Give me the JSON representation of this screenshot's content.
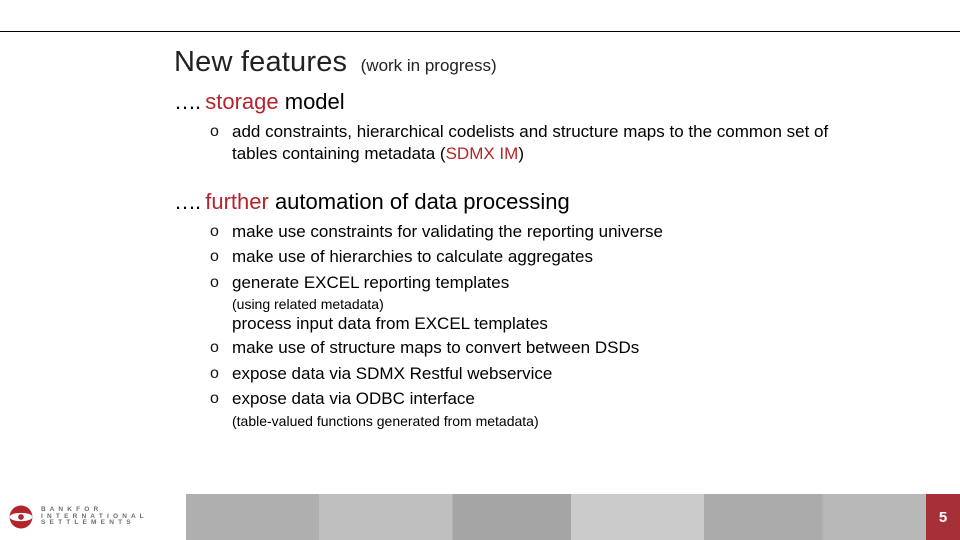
{
  "title": {
    "main": "New features",
    "sub": "(work in progress)"
  },
  "section1": {
    "dots": "…. ",
    "word": "storage",
    "rest": " model"
  },
  "s1_b1_a": "add constraints, hierarchical codelists and structure maps to the common set of tables containing metadata (",
  "s1_b1_link": "SDMX IM",
  "s1_b1_b": ")",
  "section2": {
    "dots": "…. ",
    "word": "further",
    "rest": " automation of data processing"
  },
  "s2_b1": "make use constraints for validating the reporting universe",
  "s2_b2": "make use of hierarchies to calculate aggregates",
  "s2_b3": "generate EXCEL reporting templates",
  "s2_b3_note": "(using related metadata)",
  "s2_plain": "process input data from EXCEL templates",
  "s2_b4": "make use of structure maps to convert between DSDs",
  "s2_b5": "expose data via SDMX Restful webservice",
  "s2_b6": "expose data via ODBC interface",
  "s2_b6_note": "(table-valued functions generated from metadata)",
  "bullet_marker": "o",
  "logo": {
    "line1": "B A N K  F O R",
    "line2": "I N T E R N A T I O N A L",
    "line3": "S E T T L E M E N T S"
  },
  "page_number": "5"
}
